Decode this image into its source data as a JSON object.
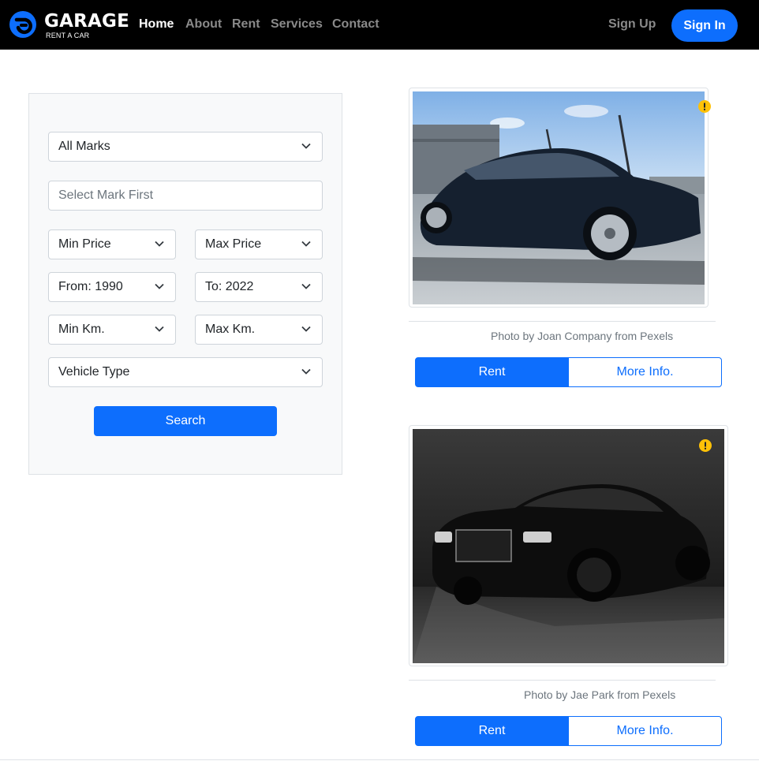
{
  "brand": {
    "title": "GARAGE",
    "subtitle": "RENT A CAR",
    "accent_color": "#0d6efd",
    "icon": "garage-logo-icon"
  },
  "nav": {
    "links": [
      "Home",
      "About",
      "Rent",
      "Services",
      "Contact"
    ],
    "active": "Home",
    "signup_label": "Sign Up",
    "signin_label": "Sign In"
  },
  "filters": {
    "marks": "All Marks",
    "model_placeholder": "Select Mark First",
    "min_price": "Min Price",
    "max_price": "Max Price",
    "year_from": "From: 1990",
    "year_to": "To: 2022",
    "min_km": "Min Km.",
    "max_km": "Max Km.",
    "vehicle_type": "Vehicle Type",
    "search_label": "Search"
  },
  "cars": [
    {
      "credit": "Photo by Joan Company from Pexels",
      "rent_label": "Rent",
      "info_label": "More Info.",
      "image": "dark-blue-sedan-photo"
    },
    {
      "credit": "Photo by Jae Park from Pexels",
      "rent_label": "Rent",
      "info_label": "More Info.",
      "image": "black-luxury-car-photo"
    }
  ]
}
